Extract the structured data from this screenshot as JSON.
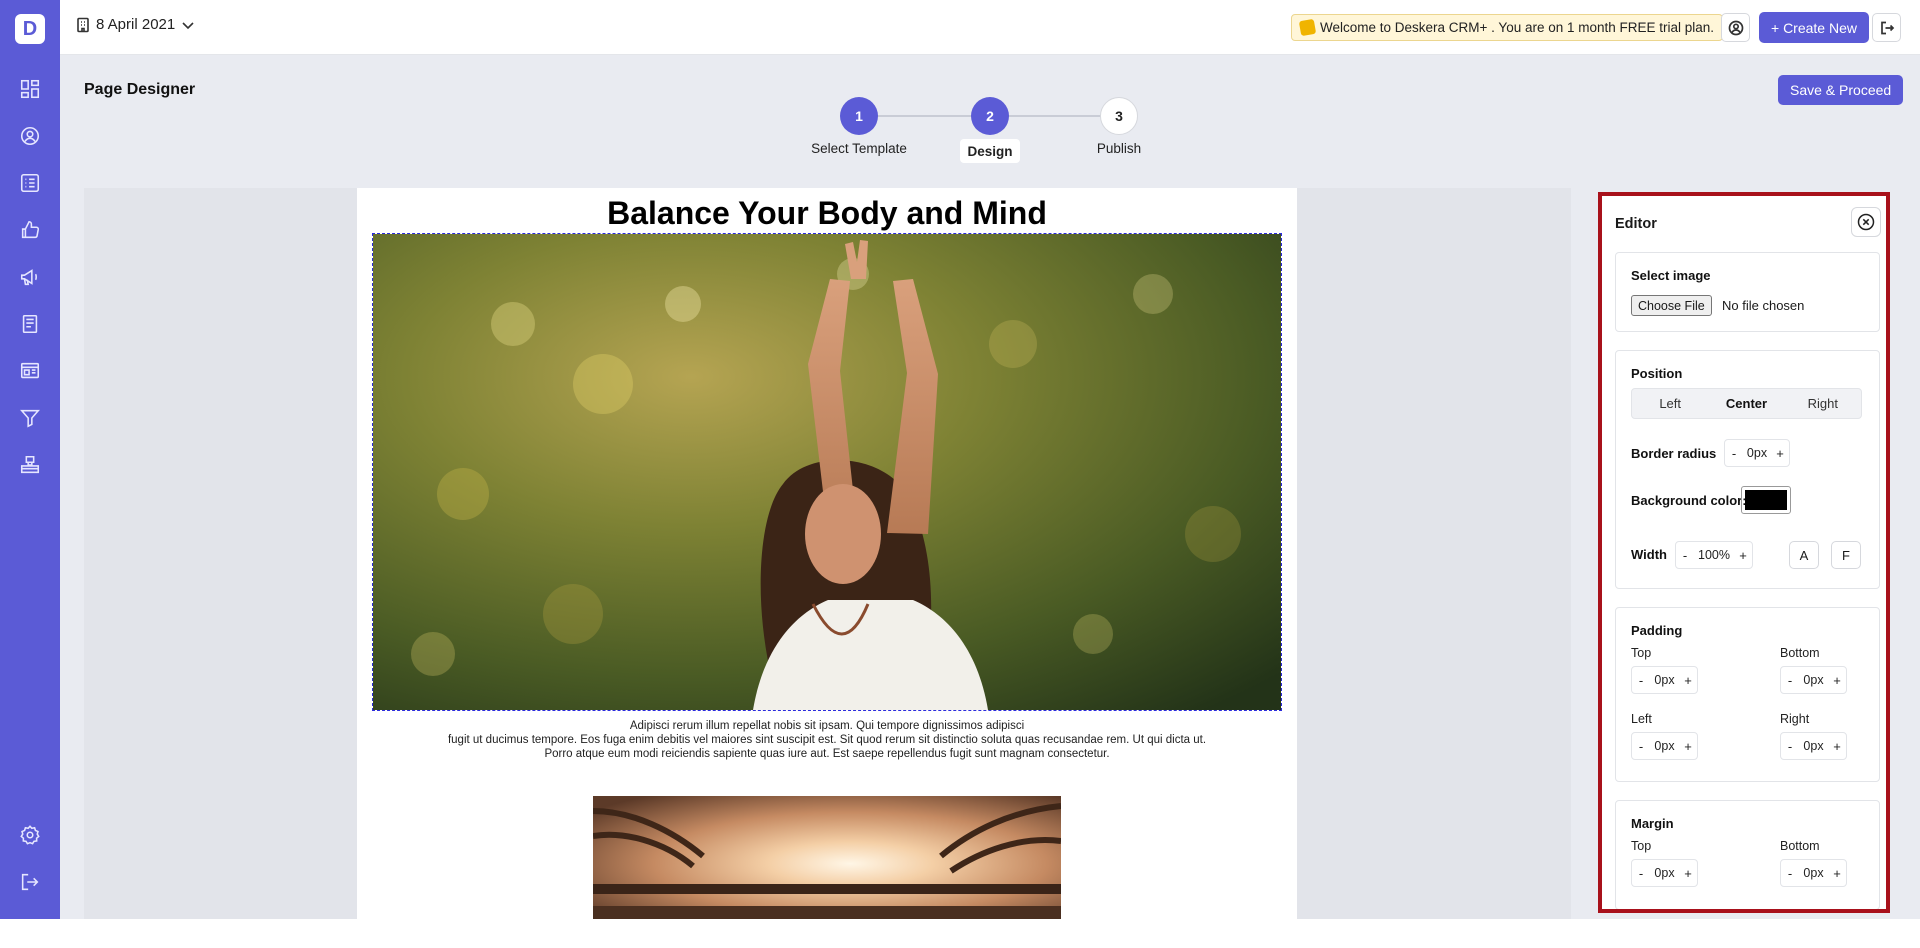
{
  "sidebar": {
    "logo": "D",
    "icons": [
      "dashboard-icon",
      "contacts-icon",
      "list-icon",
      "deals-icon",
      "campaign-icon",
      "forms-icon",
      "landing-page-icon",
      "funnel-icon",
      "inbox-icon",
      "settings-icon",
      "logout-icon"
    ]
  },
  "topbar": {
    "date": "8 April 2021",
    "trial_banner": "Welcome to Deskera CRM+ . You are on 1 month FREE trial plan.",
    "create_new": "+ Create New"
  },
  "header": {
    "title": "Page Designer",
    "save_proceed": "Save & Proceed"
  },
  "stepper": {
    "steps": [
      {
        "number": "1",
        "label": "Select Template",
        "state": "done"
      },
      {
        "number": "2",
        "label": "Design",
        "state": "current"
      },
      {
        "number": "3",
        "label": "Publish",
        "state": "pending"
      }
    ]
  },
  "canvas": {
    "heading": "Balance Your Body and Mind",
    "caption_lines": [
      "Adipisci rerum illum repellat nobis sit ipsam. Qui tempore dignissimos adipisci",
      "fugit ut ducimus tempore. Eos fuga enim debitis vel maiores sint suscipit est. Sit quod rerum sit distinctio soluta quas recusandae rem. Ut qui dicta ut.",
      "Porro atque eum modi reiciendis sapiente quas iure aut. Est saepe repellendus fugit sunt magnam consectetur."
    ]
  },
  "editor": {
    "title": "Editor",
    "select_image": {
      "label": "Select image",
      "button": "Choose File",
      "status": "No file chosen"
    },
    "position": {
      "label": "Position",
      "options": [
        "Left",
        "Center",
        "Right"
      ],
      "selected": "Center"
    },
    "border_radius": {
      "label": "Border radius",
      "value": "0px"
    },
    "background_color": {
      "label": "Background color:",
      "value": "#000000"
    },
    "width": {
      "label": "Width",
      "value": "100%",
      "auto": "A",
      "full": "F"
    },
    "padding": {
      "label": "Padding",
      "top": {
        "label": "Top",
        "value": "0px"
      },
      "bottom": {
        "label": "Bottom",
        "value": "0px"
      },
      "left": {
        "label": "Left",
        "value": "0px"
      },
      "right": {
        "label": "Right",
        "value": "0px"
      }
    },
    "margin": {
      "label": "Margin",
      "top": {
        "label": "Top",
        "value": "0px"
      },
      "bottom": {
        "label": "Bottom",
        "value": "0px"
      }
    },
    "minus": "-",
    "plus": "+"
  },
  "colors": {
    "accent": "#5b5bd6",
    "highlight_border": "#a8111b"
  }
}
